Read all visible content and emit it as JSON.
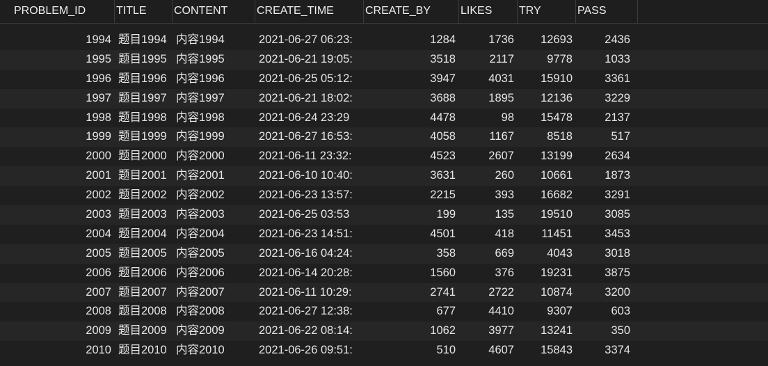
{
  "columns": [
    "PROBLEM_ID",
    "TITLE",
    "CONTENT",
    "CREATE_TIME",
    "CREATE_BY",
    "LIKES",
    "TRY",
    "PASS"
  ],
  "rows": [
    {
      "id": "1994",
      "title": "题目1994",
      "content": "内容1994",
      "create_time": "2021-06-27 06:23:",
      "create_by": "1284",
      "likes": "1736",
      "try": "12693",
      "pass": "2436"
    },
    {
      "id": "1995",
      "title": "题目1995",
      "content": "内容1995",
      "create_time": "2021-06-21 19:05:",
      "create_by": "3518",
      "likes": "2117",
      "try": "9778",
      "pass": "1033"
    },
    {
      "id": "1996",
      "title": "题目1996",
      "content": "内容1996",
      "create_time": "2021-06-25 05:12:",
      "create_by": "3947",
      "likes": "4031",
      "try": "15910",
      "pass": "3361"
    },
    {
      "id": "1997",
      "title": "题目1997",
      "content": "内容1997",
      "create_time": "2021-06-21 18:02:",
      "create_by": "3688",
      "likes": "1895",
      "try": "12136",
      "pass": "3229"
    },
    {
      "id": "1998",
      "title": "题目1998",
      "content": "内容1998",
      "create_time": "2021-06-24 23:29",
      "create_by": "4478",
      "likes": "98",
      "try": "15478",
      "pass": "2137"
    },
    {
      "id": "1999",
      "title": "题目1999",
      "content": "内容1999",
      "create_time": "2021-06-27 16:53:",
      "create_by": "4058",
      "likes": "1167",
      "try": "8518",
      "pass": "517"
    },
    {
      "id": "2000",
      "title": "题目2000",
      "content": "内容2000",
      "create_time": "2021-06-11 23:32:",
      "create_by": "4523",
      "likes": "2607",
      "try": "13199",
      "pass": "2634"
    },
    {
      "id": "2001",
      "title": "题目2001",
      "content": "内容2001",
      "create_time": "2021-06-10 10:40:",
      "create_by": "3631",
      "likes": "260",
      "try": "10661",
      "pass": "1873"
    },
    {
      "id": "2002",
      "title": "题目2002",
      "content": "内容2002",
      "create_time": "2021-06-23 13:57:",
      "create_by": "2215",
      "likes": "393",
      "try": "16682",
      "pass": "3291"
    },
    {
      "id": "2003",
      "title": "题目2003",
      "content": "内容2003",
      "create_time": "2021-06-25 03:53",
      "create_by": "199",
      "likes": "135",
      "try": "19510",
      "pass": "3085"
    },
    {
      "id": "2004",
      "title": "题目2004",
      "content": "内容2004",
      "create_time": "2021-06-23 14:51:",
      "create_by": "4501",
      "likes": "418",
      "try": "11451",
      "pass": "3453"
    },
    {
      "id": "2005",
      "title": "题目2005",
      "content": "内容2005",
      "create_time": "2021-06-16 04:24:",
      "create_by": "358",
      "likes": "669",
      "try": "4043",
      "pass": "3018"
    },
    {
      "id": "2006",
      "title": "题目2006",
      "content": "内容2006",
      "create_time": "2021-06-14 20:28:",
      "create_by": "1560",
      "likes": "376",
      "try": "19231",
      "pass": "3875"
    },
    {
      "id": "2007",
      "title": "题目2007",
      "content": "内容2007",
      "create_time": "2021-06-11 10:29:",
      "create_by": "2741",
      "likes": "2722",
      "try": "10874",
      "pass": "3200"
    },
    {
      "id": "2008",
      "title": "题目2008",
      "content": "内容2008",
      "create_time": "2021-06-27 12:38:",
      "create_by": "677",
      "likes": "4410",
      "try": "9307",
      "pass": "603"
    },
    {
      "id": "2009",
      "title": "题目2009",
      "content": "内容2009",
      "create_time": "2021-06-22 08:14:",
      "create_by": "1062",
      "likes": "3977",
      "try": "13241",
      "pass": "350"
    },
    {
      "id": "2010",
      "title": "题目2010",
      "content": "内容2010",
      "create_time": "2021-06-26 09:51:",
      "create_by": "510",
      "likes": "4607",
      "try": "15843",
      "pass": "3374"
    }
  ]
}
